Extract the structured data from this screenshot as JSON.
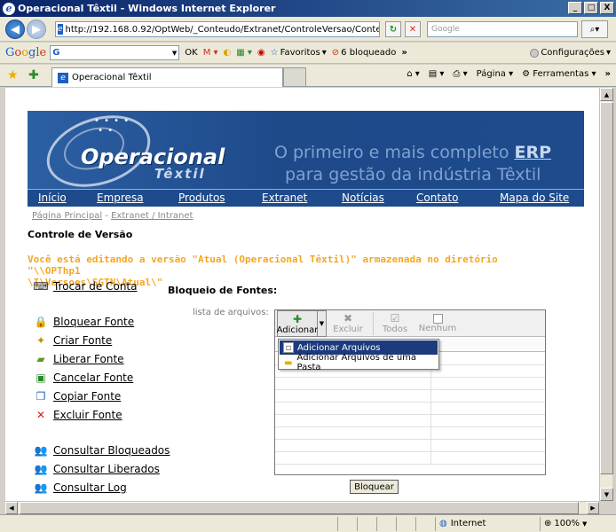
{
  "window": {
    "title": "Operacional Têxtil - Windows Internet Explorer",
    "buttons": [
      "_",
      "□",
      "X"
    ]
  },
  "address_bar": {
    "url": "http://192.168.0.92/OptWeb/_Conteudo/Extranet/ControleVersao/Conteud",
    "search_placeholder": "Google"
  },
  "google_toolbar": {
    "logo": "Google",
    "search_value": "G",
    "items": {
      "ok": "OK",
      "favoritos": "Favoritos",
      "bloqueado": "6 bloqueado",
      "more": "»",
      "configuracoes": "Configurações"
    }
  },
  "tab": {
    "title": "Operacional Têxtil"
  },
  "command_bar": {
    "pagina": "Página",
    "ferramentas": "Ferramentas",
    "more": "»"
  },
  "banner": {
    "brand_top": "Operacional",
    "brand_bottom": "Têxtil",
    "slogan_line1_pre": "O primeiro e mais completo",
    "slogan_line1_erp": "ERP",
    "slogan_line2": "para gestão da indústria Têxtil"
  },
  "nav": {
    "items": [
      "Início",
      "Empresa",
      "Produtos",
      "Extranet",
      "Notícias",
      "Contato",
      "Mapa do Site"
    ]
  },
  "breadcrumb": {
    "home": "Página Principal",
    "sep": "-",
    "current": "Extranet / Intranet"
  },
  "page": {
    "title": "Controle de Versão",
    "notice_line1": "Você está editando a versão \"Atual (Operacional Têxtil)\" armazenada no diretório \"\\\\OPThp1",
    "notice_line2": "\\I\\Versoes\\SGTN\\Atual\\\""
  },
  "sidebar": {
    "items": [
      {
        "label": "Trocar de Conta",
        "icon": "keyboard-icon"
      },
      {
        "label": "Bloquear Fonte",
        "icon": "lock-user-icon"
      },
      {
        "label": "Criar Fonte",
        "icon": "new-file-icon"
      },
      {
        "label": "Liberar Fonte",
        "icon": "unlock-folder-icon"
      },
      {
        "label": "Cancelar Fonte",
        "icon": "cancel-file-icon"
      },
      {
        "label": "Copiar Fonte",
        "icon": "copy-icon"
      },
      {
        "label": "Excluir Fonte",
        "icon": "delete-icon"
      },
      {
        "label": "Consultar Bloqueados",
        "icon": "users-lock-icon"
      },
      {
        "label": "Consultar Liberados",
        "icon": "users-unlock-icon"
      },
      {
        "label": "Consultar Log",
        "icon": "users-log-icon"
      }
    ]
  },
  "fonts_section": {
    "title": "Bloqueio de Fontes:",
    "file_list_label": "lista de arquivos:",
    "toolbar": {
      "add": "Adicionar",
      "delete": "Excluir",
      "all": "Todos",
      "none": "Nenhum"
    },
    "add_menu": [
      "Adicionar Arquivos",
      "Adicionar Arquivos de uma Pasta"
    ],
    "lock_button": "Bloquear"
  },
  "status_bar": {
    "zone": "Internet",
    "zoom": "100%"
  }
}
